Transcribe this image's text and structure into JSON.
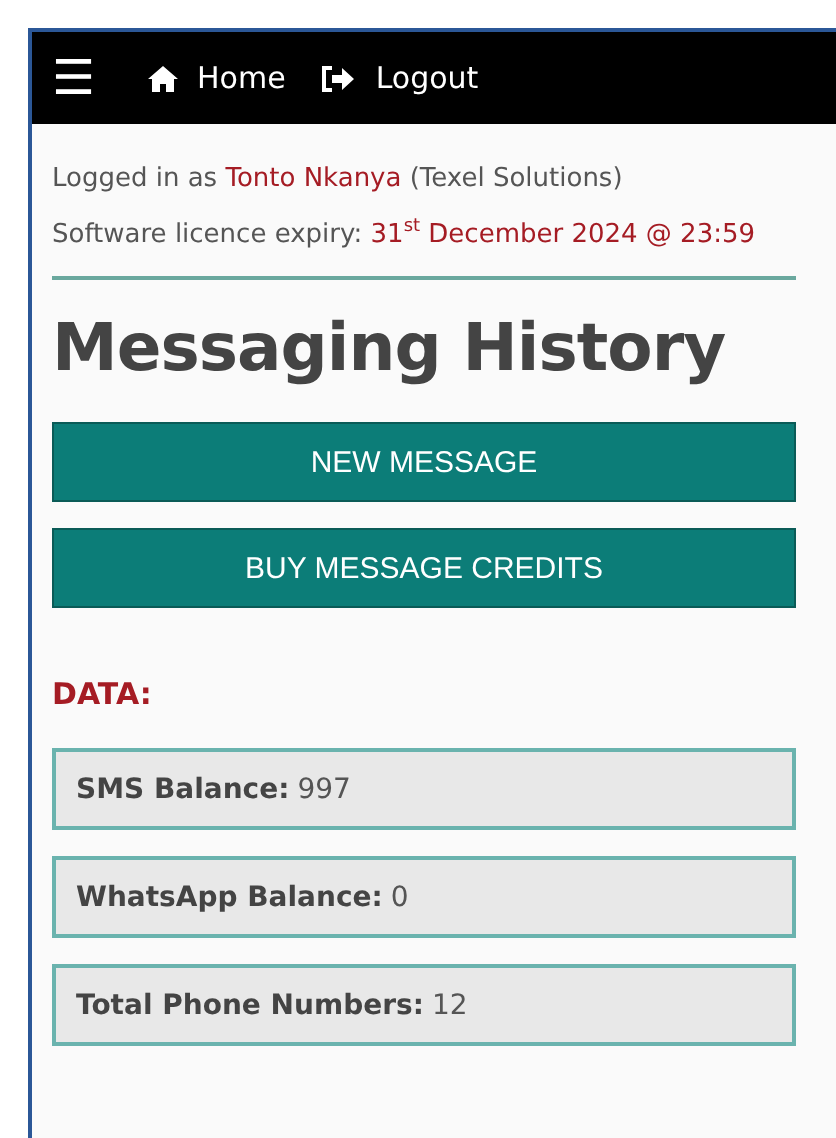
{
  "navbar": {
    "menu_icon": "☰",
    "links": [
      {
        "kind": "home",
        "label": "Home"
      },
      {
        "kind": "logout",
        "label": "Logout"
      }
    ]
  },
  "login": {
    "prefix": "Logged in as",
    "user": "Tonto Nkanya",
    "org": "(Texel Solutions)"
  },
  "licence": {
    "label": "Software licence expiry:",
    "expiry": "31$^{st}$ December 2024 @ 23:59"
  },
  "title": "Messaging History",
  "buttons": [
    "NEW MESSAGE",
    "BUY MESSAGE CREDITS"
  ],
  "data_heading": "DATA:",
  "stats": [
    {
      "label": "SMS Balance:",
      "value": "997"
    },
    {
      "label": "WhatsApp Balance:",
      "value": "0"
    },
    {
      "label": "Total Phone Numbers:",
      "value": "12"
    }
  ]
}
